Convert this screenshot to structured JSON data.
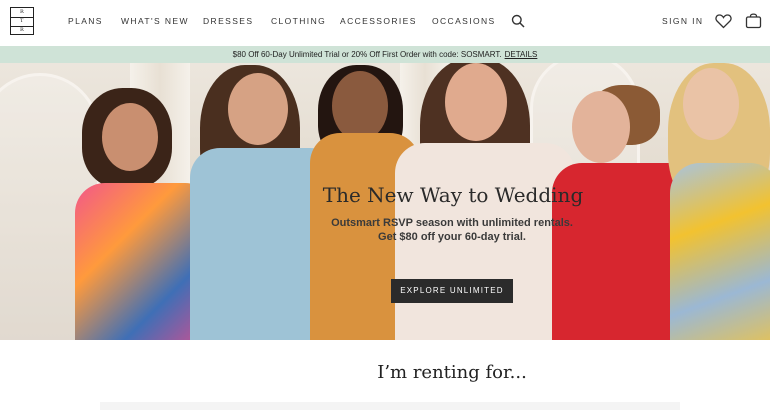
{
  "header": {
    "logo_icon": "rtr-logo-icon",
    "nav": [
      "PLANS",
      "WHAT'S NEW",
      "DRESSES",
      "CLOTHING",
      "ACCESSORIES",
      "OCCASIONS"
    ],
    "search_icon": "search-icon",
    "sign_in": "SIGN IN",
    "heart_icon": "heart-icon",
    "bag_icon": "bag-icon"
  },
  "promo": {
    "text": "$80 Off 60-Day Unlimited Trial or 20% Off First Order with code: SOSMART.",
    "details": "DETAILS",
    "background": "#cfe3d7"
  },
  "hero": {
    "title": "The New Way to Wedding",
    "subtitle_line1": "Outsmart RSVP season with unlimited rentals.",
    "subtitle_line2": "Get $80 off your 60-day trial.",
    "cta": "EXPLORE UNLIMITED"
  },
  "section": {
    "heading": "I’m renting for..."
  }
}
